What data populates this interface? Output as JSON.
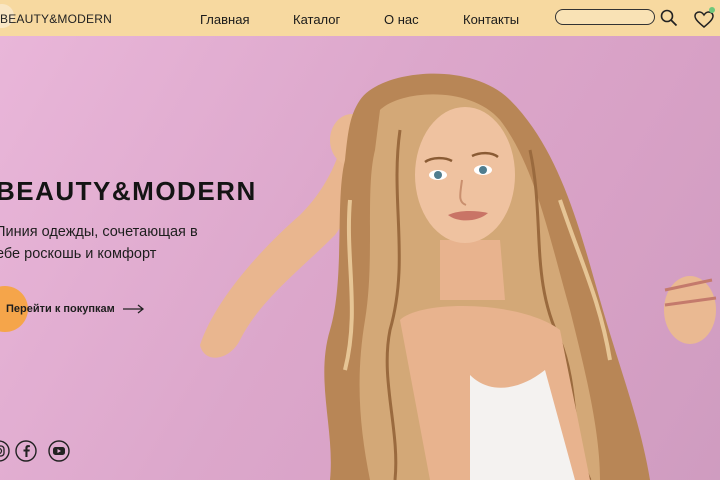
{
  "header": {
    "logo": "BEAUTY&MODERN",
    "nav": [
      "Главная",
      "Каталог",
      "О нас",
      "Контакты"
    ],
    "search": {
      "value": "",
      "placeholder": ""
    },
    "icons": {
      "search": "search-icon",
      "wishlist": "heart-icon"
    }
  },
  "hero": {
    "title": "BEAUTY&MODERN",
    "subtitle_line1": "Линия одежды, сочетающая в",
    "subtitle_line2": "ебе роскошь и комфорт",
    "cta_label": "Перейти к покупкам",
    "cta_icon": "arrow-right-icon"
  },
  "social": [
    "instagram-icon",
    "facebook-icon",
    "youtube-icon"
  ],
  "colors": {
    "header_bg": "#f7d9a0",
    "hero_bg": "#dca7cb",
    "accent": "#f5a54a",
    "text": "#141414",
    "notification_dot": "#6ec87a"
  }
}
